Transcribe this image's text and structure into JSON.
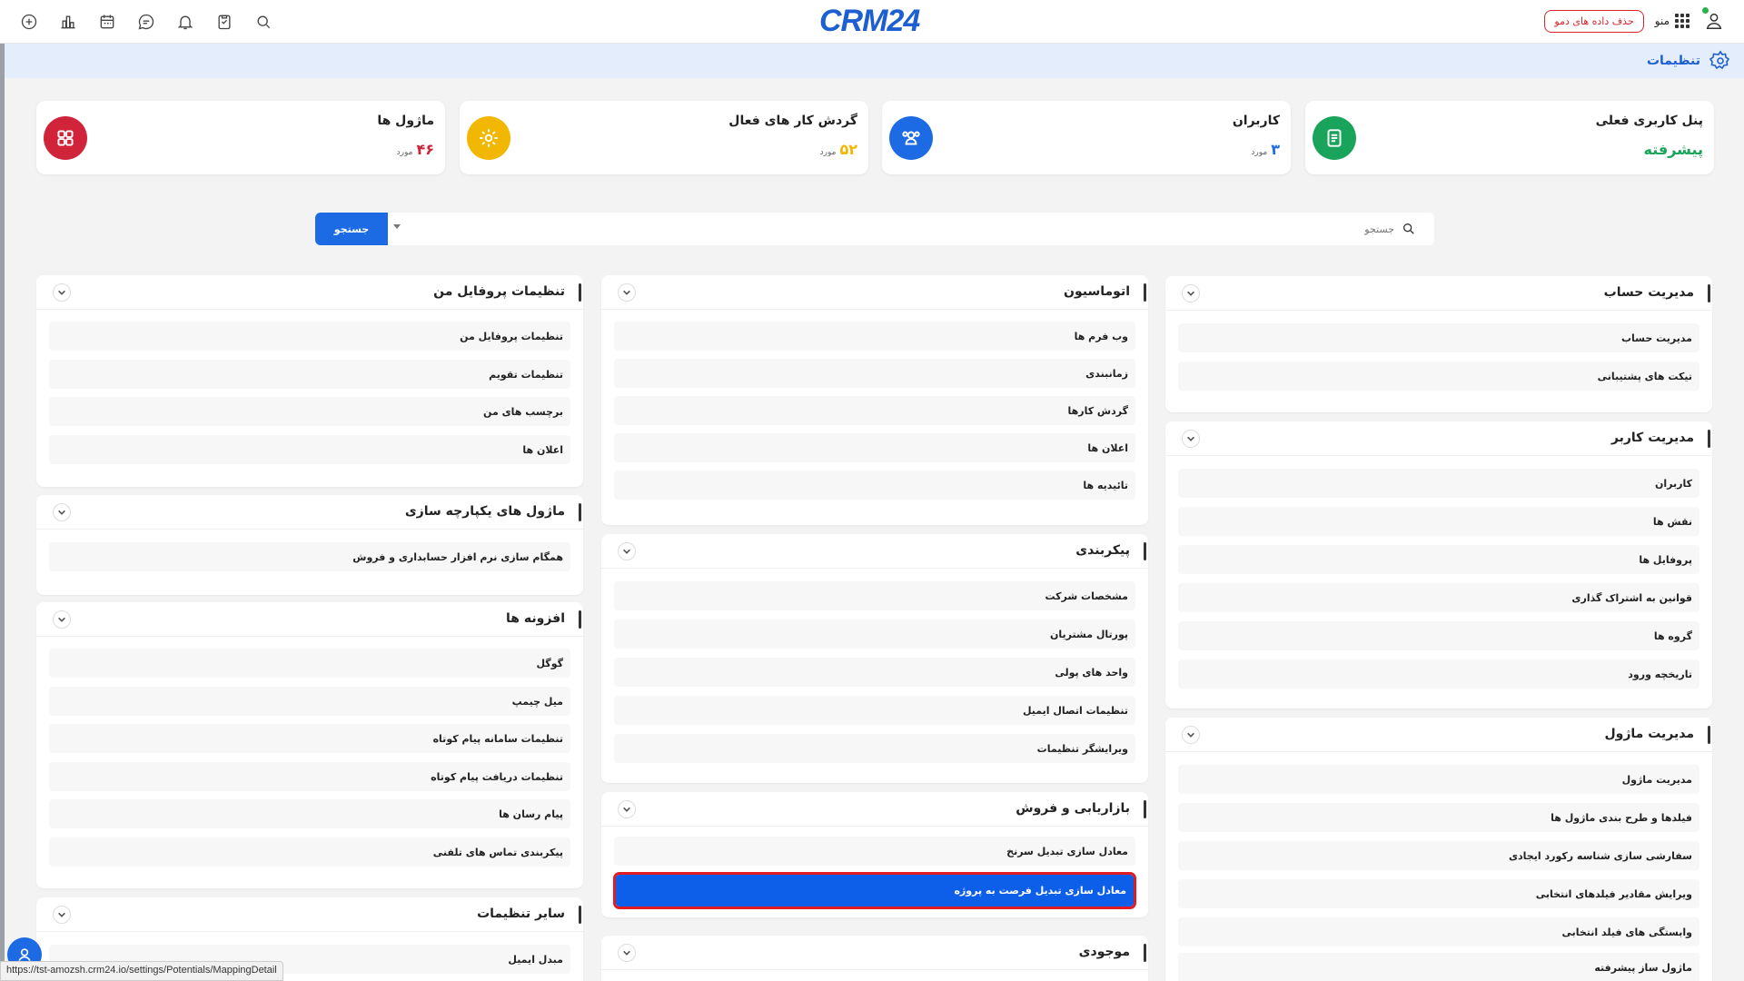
{
  "header": {
    "logo_text": "CRM",
    "logo_num": "24",
    "menu_label": "منو",
    "demo_button": "حذف داده های دمو",
    "icons_left": [
      "add-circle-icon",
      "chart-icon",
      "calendar-icon",
      "chat-icon",
      "bell-icon",
      "clipboard-icon",
      "search-icon"
    ]
  },
  "subheader": {
    "title": "تنظیمات"
  },
  "stats": [
    {
      "label": "پنل کاربری فعلی",
      "value": "پیشرفته",
      "unit": "",
      "color": "#1aa35a"
    },
    {
      "label": "کاربران",
      "value": "۳",
      "unit": "مورد",
      "color": "#1d6ae5"
    },
    {
      "label": "گردش کار های فعال",
      "value": "۵۲",
      "unit": "مورد",
      "color": "#f2b700"
    },
    {
      "label": "ماژول ها",
      "value": "۴۶",
      "unit": "مورد",
      "color": "#d0243a"
    }
  ],
  "search": {
    "placeholder": "جستجو",
    "button": "جستجو"
  },
  "sections": {
    "account": {
      "title": "مدیریت حساب",
      "items": [
        "مدیریت حساب",
        "تیکت های پشتیبانی"
      ]
    },
    "user": {
      "title": "مدیریت کاربر",
      "items": [
        "کاربران",
        "نقش ها",
        "پروفایل ها",
        "قوانین به اشتراک گذاری",
        "گروه ها",
        "تاریخچه ورود"
      ]
    },
    "module": {
      "title": "مدیریت ماژول",
      "items": [
        "مدیریت ماژول",
        "فیلدها و طرح بندی ماژول ها",
        "سفارشی سازی شناسه رکورد ایجادی",
        "ویرایش مقادیر فیلدهای انتخابی",
        "وابستگی های فیلد انتخابی",
        "ماژول ساز پیشرفته"
      ]
    },
    "automation": {
      "title": "اتوماسیون",
      "items": [
        "وب فرم ها",
        "زمانبندی",
        "گردش کارها",
        "اعلان ها",
        "تائیدیه ها"
      ]
    },
    "config": {
      "title": "پیکربندی",
      "items": [
        "مشخصات شرکت",
        "پورتال مشتریان",
        "واحد های پولی",
        "تنظیمات اتصال ایمیل",
        "ویرایشگر تنظیمات"
      ]
    },
    "marketing": {
      "title": "بازاریابی و فروش",
      "items": [
        "معادل سازی تبدیل سرنخ",
        "معادل سازی تبدیل فرصت به پروژه"
      ]
    },
    "inventory": {
      "title": "موجودی"
    },
    "profile": {
      "title": "تنظیمات پروفایل من",
      "items": [
        "تنظیمات پروفایل من",
        "تنظیمات تقویم",
        "برچسب های من",
        "اعلان ها"
      ]
    },
    "integration": {
      "title": "ماژول های یکپارچه سازی",
      "items": [
        "همگام سازی نرم افزار حسابداری و فروش"
      ]
    },
    "addons": {
      "title": "افزونه ها",
      "items": [
        "گوگل",
        "میل چیمپ",
        "تنظیمات سامانه پیام کوتاه",
        "تنظیمات دریافت پیام کوتاه",
        "پیام رسان ها",
        "پیکربندی تماس های تلفنی"
      ]
    },
    "other": {
      "title": "سایر تنظیمات",
      "items": [
        "مبدل ایمیل"
      ]
    }
  },
  "status_url": "https://tst-amozsh.crm24.io/settings/Potentials/MappingDetail"
}
